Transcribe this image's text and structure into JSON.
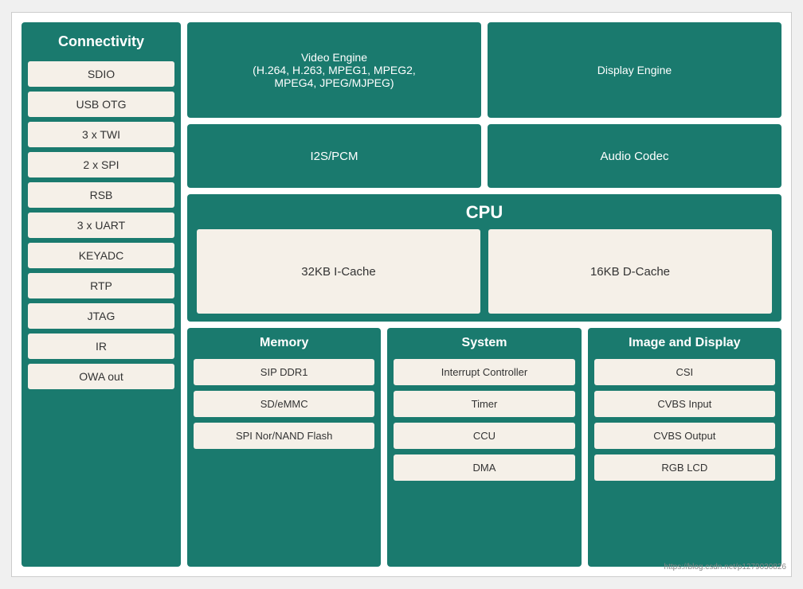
{
  "connectivity": {
    "title": "Connectivity",
    "items": [
      "SDIO",
      "USB OTG",
      "3 x TWI",
      "2 x SPI",
      "RSB",
      "3 x UART",
      "KEYADC",
      "RTP",
      "JTAG",
      "IR",
      "OWA out"
    ]
  },
  "top_row": {
    "video_engine": "Video Engine\n(H.264, H.263, MPEG1, MPEG2,\nMPEG4, JPEG/MJPEG)",
    "display_engine": "Display Engine"
  },
  "second_row": {
    "i2s": "I2S/PCM",
    "audio_codec": "Audio Codec"
  },
  "cpu": {
    "title": "CPU",
    "icache": "32KB I-Cache",
    "dcache": "16KB D-Cache"
  },
  "memory": {
    "title": "Memory",
    "items": [
      "SIP DDR1",
      "SD/eMMC",
      "SPI Nor/NAND Flash"
    ]
  },
  "system": {
    "title": "System",
    "items": [
      "Interrupt Controller",
      "Timer",
      "CCU",
      "DMA"
    ]
  },
  "image_display": {
    "title": "Image and Display",
    "items": [
      "CSI",
      "CVBS Input",
      "CVBS Output",
      "RGB LCD"
    ]
  },
  "watermark": "https://blog.csdn.net/p1279030826"
}
